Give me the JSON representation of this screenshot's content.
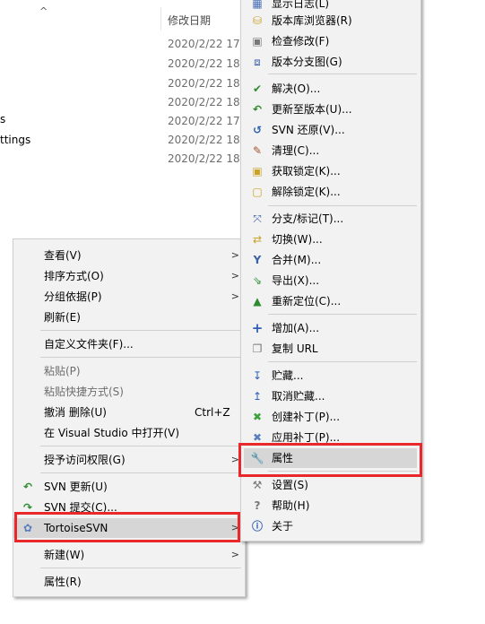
{
  "explorer": {
    "column_date": "修改日期",
    "left_fragments": [
      "s",
      "ttings"
    ],
    "dates": [
      "2020/2/22 17:",
      "2020/2/22 18:",
      "2020/2/22 18:",
      "2020/2/22 18:",
      "2020/2/22 17:",
      "2020/2/22 18:",
      "2020/2/22 18:"
    ]
  },
  "context_menu": {
    "items": [
      {
        "label": "查看(V)"
      },
      {
        "label": "排序方式(O)"
      },
      {
        "label": "分组依据(P)"
      },
      {
        "label": "刷新(E)"
      },
      {
        "label": "自定义文件夹(F)..."
      },
      {
        "label": "粘贴(P)"
      },
      {
        "label": "粘贴快捷方式(S)"
      },
      {
        "label": "撤消 删除(U)",
        "shortcut": "Ctrl+Z"
      },
      {
        "label": "在 Visual Studio 中打开(V)"
      },
      {
        "label": "授予访问权限(G)"
      },
      {
        "label": "SVN 更新(U)"
      },
      {
        "label": "SVN 提交(C)..."
      },
      {
        "label": "TortoiseSVN"
      },
      {
        "label": "新建(W)"
      },
      {
        "label": "属性(R)"
      }
    ]
  },
  "svn_menu": {
    "items": [
      {
        "label": "显示日志(L)"
      },
      {
        "label": "版本库浏览器(R)"
      },
      {
        "label": "检查修改(F)"
      },
      {
        "label": "版本分支图(G)"
      },
      {
        "label": "解决(O)..."
      },
      {
        "label": "更新至版本(U)..."
      },
      {
        "label": "SVN 还原(V)..."
      },
      {
        "label": "清理(C)..."
      },
      {
        "label": "获取锁定(K)..."
      },
      {
        "label": "解除锁定(K)..."
      },
      {
        "label": "分支/标记(T)..."
      },
      {
        "label": "切换(W)..."
      },
      {
        "label": "合并(M)..."
      },
      {
        "label": "导出(X)..."
      },
      {
        "label": "重新定位(C)..."
      },
      {
        "label": "增加(A)..."
      },
      {
        "label": "复制 URL"
      },
      {
        "label": "贮藏..."
      },
      {
        "label": "取消贮藏..."
      },
      {
        "label": "创建补丁(P)..."
      },
      {
        "label": "应用补丁(P)..."
      },
      {
        "label": "属性"
      },
      {
        "label": "设置(S)"
      },
      {
        "label": "帮助(H)"
      },
      {
        "label": "关于"
      }
    ]
  }
}
